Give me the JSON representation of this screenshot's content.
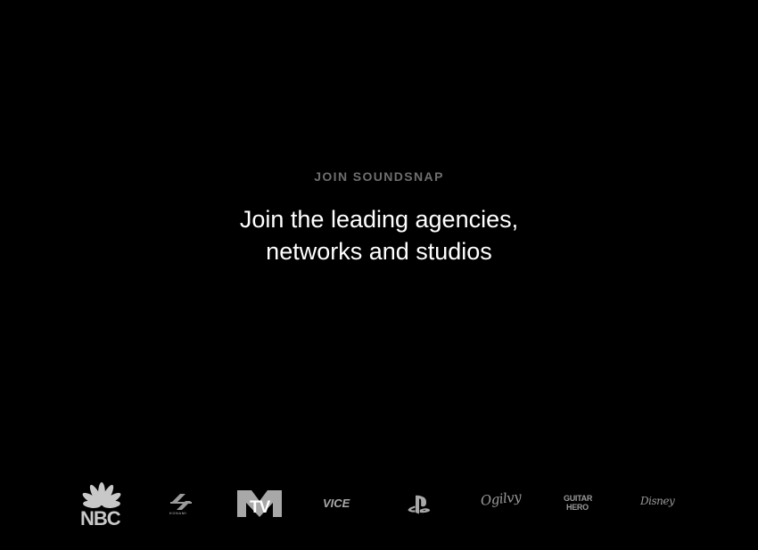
{
  "hero": {
    "eyebrow": "JOIN SOUNDSNAP",
    "headline_line1": "Join the leading agencies,",
    "headline_line2": "networks and studios"
  },
  "logos": [
    {
      "name": "nbc-logo",
      "text": "NBC"
    },
    {
      "name": "konami-logo",
      "text": "KONAMI"
    },
    {
      "name": "mtv-logo",
      "text": "TV"
    },
    {
      "name": "vice-logo",
      "text": "VICE"
    },
    {
      "name": "playstation-logo",
      "icon": "playstation-icon"
    },
    {
      "name": "ogilvy-logo",
      "text": "Ogilvy"
    },
    {
      "name": "guitar-hero-logo",
      "text_line1": "GUITAR",
      "text_line2": "HERO"
    },
    {
      "name": "disney-logo",
      "text": "Disney"
    }
  ],
  "colors": {
    "background": "#000000",
    "eyebrow": "#6e6e6e",
    "headline": "#ffffff",
    "logo": "#bdbdbd"
  }
}
